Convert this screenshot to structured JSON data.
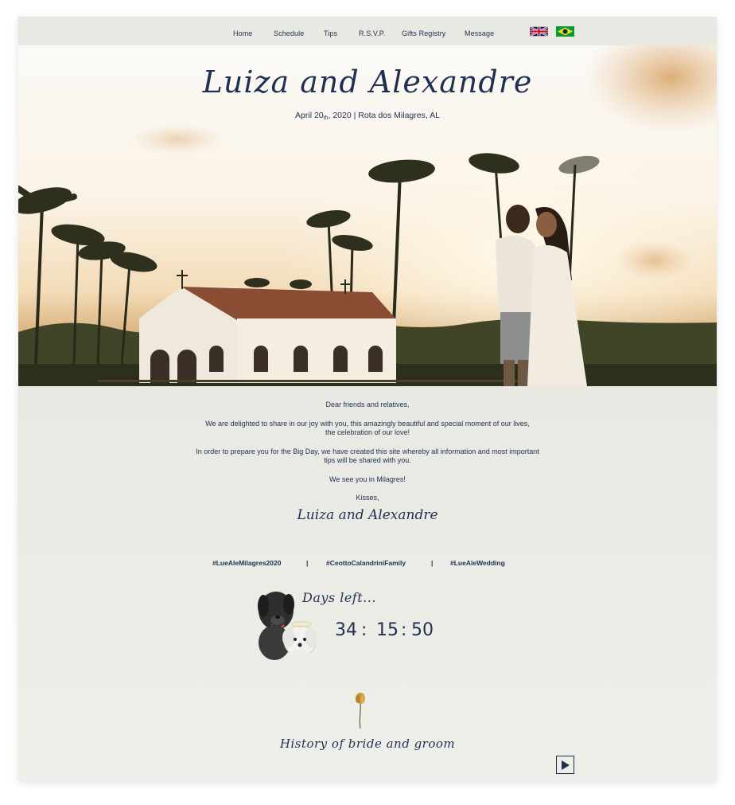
{
  "nav": {
    "items": [
      {
        "label": "Home"
      },
      {
        "label": "Schedule"
      },
      {
        "label": "Tips"
      },
      {
        "label": "R.S.V.P."
      },
      {
        "label": "Gifts Registry"
      },
      {
        "label": "Message"
      }
    ],
    "languages": [
      {
        "icon": "uk-flag-icon"
      },
      {
        "icon": "brazil-flag-icon"
      }
    ]
  },
  "hero": {
    "title": "Luiza and Alexandre",
    "date_day": "April 20",
    "date_suffix": "th",
    "date_rest": ", 2020 | Rota dos Milagres, AL"
  },
  "letter": {
    "greeting": "Dear friends and relatives,",
    "p1_line1": "We are delighted to share in our joy with you, this amazingly beautiful and special moment of our lives,",
    "p1_line2": "the celebration of our love!",
    "p2_line1": "In order to prepare you for the Big Day, we have created this site whereby all information and most important",
    "p2_line2": "tips will be shared with you.",
    "p3": "We see you in Milagres!",
    "closing": "Kisses,",
    "signature": "Luiza and Alexandre"
  },
  "hashtags": {
    "items": [
      "#LueAleMilagres2020",
      "#CeottoCalandriniFamily",
      "#LueAleWedding"
    ],
    "separator": "|"
  },
  "countdown": {
    "label": "Days left...",
    "days": "34",
    "hours": "15",
    "minutes": "50",
    "separator": ":"
  },
  "history": {
    "title": "History of bride and groom"
  },
  "colors": {
    "text": "#1f3050",
    "background": "#ecece7"
  }
}
